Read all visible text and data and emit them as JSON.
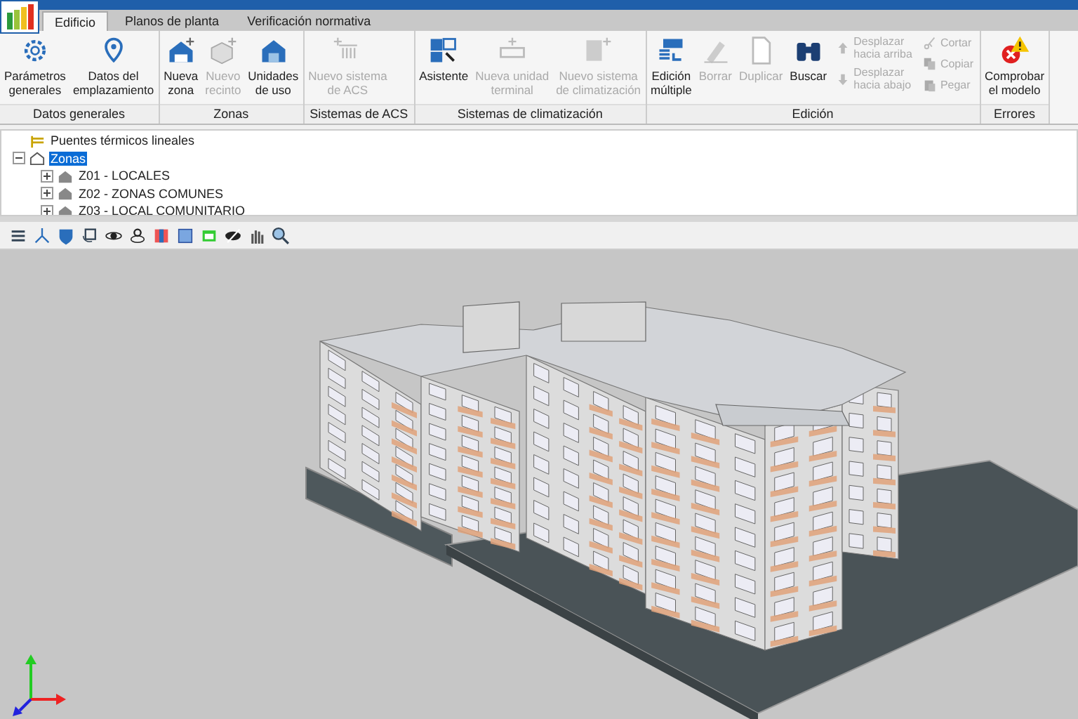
{
  "tabs": [
    {
      "label": "Edificio",
      "selected": true
    },
    {
      "label": "Planos de planta",
      "selected": false
    },
    {
      "label": "Verificación normativa",
      "selected": false
    }
  ],
  "ribbon": [
    {
      "label": "Datos generales",
      "buttons": [
        {
          "kind": "large",
          "label": "Parámetros\ngenerales",
          "disabled": false
        },
        {
          "kind": "large",
          "label": "Datos del\nemplazamiento",
          "disabled": false
        }
      ]
    },
    {
      "label": "Zonas",
      "buttons": [
        {
          "kind": "large",
          "label": "Nueva\nzona",
          "disabled": false
        },
        {
          "kind": "large",
          "label": "Nuevo\nrecinto",
          "disabled": true
        },
        {
          "kind": "large",
          "label": "Unidades\nde uso",
          "disabled": false
        }
      ]
    },
    {
      "label": "Sistemas de ACS",
      "buttons": [
        {
          "kind": "large",
          "label": "Nuevo sistema\nde ACS",
          "disabled": true
        }
      ]
    },
    {
      "label": "Sistemas de climatización",
      "buttons": [
        {
          "kind": "large",
          "label": "Asistente",
          "disabled": false
        },
        {
          "kind": "large",
          "label": "Nueva unidad\nterminal",
          "disabled": true
        },
        {
          "kind": "large",
          "label": "Nuevo sistema\nde climatización",
          "disabled": true
        }
      ]
    },
    {
      "label": "Edición",
      "buttons": [
        {
          "kind": "large",
          "label": "Edición\nmúltiple",
          "disabled": false
        },
        {
          "kind": "large",
          "label": "Borrar",
          "disabled": true
        },
        {
          "kind": "large",
          "label": "Duplicar",
          "disabled": true
        },
        {
          "kind": "large",
          "label": "Buscar",
          "disabled": false
        },
        {
          "kind": "small",
          "label": "Desplazar\nhacia arriba",
          "disabled": true
        },
        {
          "kind": "small",
          "label": "Desplazar\nhacia abajo",
          "disabled": true
        },
        {
          "kind": "small",
          "label": "Cortar",
          "disabled": true
        },
        {
          "kind": "small",
          "label": "Copiar",
          "disabled": true
        },
        {
          "kind": "small",
          "label": "Pegar",
          "disabled": true
        }
      ]
    },
    {
      "label": "Errores",
      "buttons": [
        {
          "kind": "large",
          "label": "Comprobar\nel modelo",
          "disabled": false
        }
      ]
    }
  ],
  "tree": [
    {
      "label": "Puentes térmicos lineales",
      "selected": false
    },
    {
      "label": "Zonas",
      "selected": true,
      "expanded": true,
      "children": [
        {
          "label": "Z01 - LOCALES",
          "selected": false,
          "expanded": false
        },
        {
          "label": "Z02 - ZONAS COMUNES",
          "selected": false,
          "expanded": false
        },
        {
          "label": "Z03 - LOCAL COMUNITARIO",
          "selected": false,
          "expanded": false
        }
      ]
    }
  ]
}
